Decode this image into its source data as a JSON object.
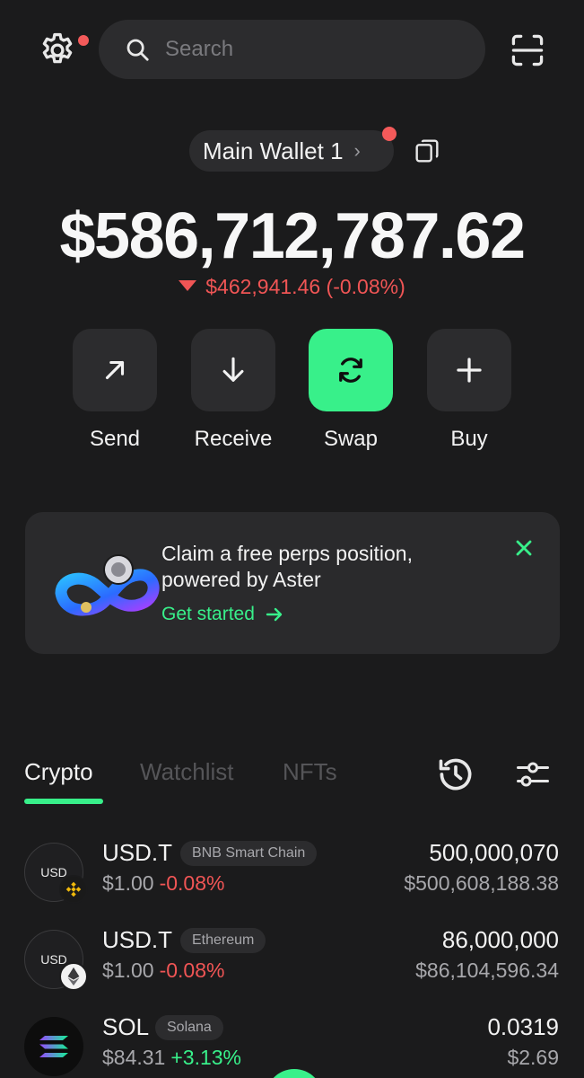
{
  "search": {
    "placeholder": "Search"
  },
  "wallet": {
    "name": "Main Wallet 1",
    "chevron": "›"
  },
  "balance": {
    "total": "$586,712,787.62",
    "change": "$462,941.46 (-0.08%)"
  },
  "actions": [
    {
      "label": "Send",
      "icon": "arrow-up-right-icon"
    },
    {
      "label": "Receive",
      "icon": "arrow-down-icon"
    },
    {
      "label": "Swap",
      "icon": "swap-icon"
    },
    {
      "label": "Buy",
      "icon": "plus-icon"
    }
  ],
  "promo": {
    "title": "Claim a free perps position, powered by Aster",
    "cta": "Get started"
  },
  "tabs": [
    {
      "label": "Crypto",
      "active": true
    },
    {
      "label": "Watchlist",
      "active": false
    },
    {
      "label": "NFTs",
      "active": false
    }
  ],
  "assets": [
    {
      "icon_text": "USD",
      "symbol": "USD.T",
      "chain": "BNB Smart Chain",
      "price": "$1.00",
      "change": "-0.08%",
      "quantity": "500,000,070",
      "value": "$500,608,188.38"
    },
    {
      "icon_text": "USD",
      "symbol": "USD.T",
      "chain": "Ethereum",
      "price": "$1.00",
      "change": "-0.08%",
      "quantity": "86,000,000",
      "value": "$86,104,596.34"
    },
    {
      "icon_text": "",
      "symbol": "SOL",
      "chain": "Solana",
      "price": "$84.31",
      "change": "+3.13%",
      "quantity": "0.0319",
      "value": "$2.69"
    }
  ],
  "colors": {
    "background": "#1b1b1c",
    "surface": "#2c2c2e",
    "accent": "#38f08a",
    "negative": "#f05555",
    "notification": "#f35a5a"
  }
}
